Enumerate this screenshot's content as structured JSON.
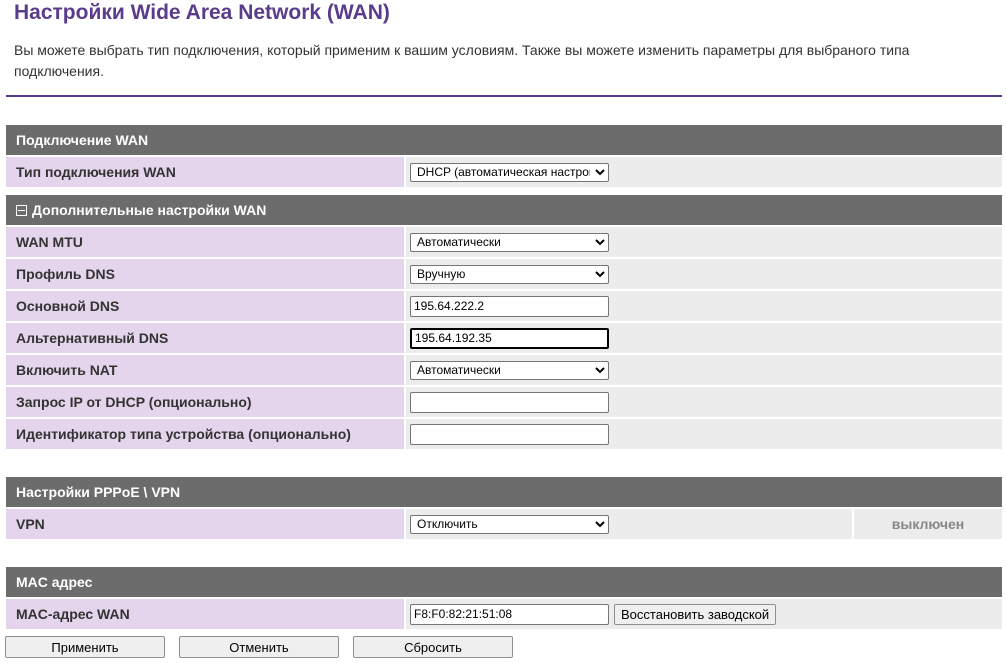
{
  "page": {
    "title": "Настройки Wide Area Network (WAN)",
    "description": "Вы можете выбрать тип подключения, который применим к вашим условиям. Также вы можете изменить параметры для выбраного типа подключения."
  },
  "wan_connection": {
    "header": "Подключение WAN",
    "type_label": "Тип подключения WAN",
    "type_value": "DHCP (автоматическая настройка)"
  },
  "advanced": {
    "header": "Дополнительные настройки WAN",
    "mtu_label": "WAN MTU",
    "mtu_value": "Автоматически",
    "dns_profile_label": "Профиль DNS",
    "dns_profile_value": "Вручную",
    "primary_dns_label": "Основной DNS",
    "primary_dns_value": "195.64.222.2",
    "alt_dns_label": "Альтернативный DNS",
    "alt_dns_value": "195.64.192.35",
    "nat_label": "Включить NAT",
    "nat_value": "Автоматически",
    "dhcp_ip_label": "Запрос IP от DHCP (опционально)",
    "dhcp_ip_value": "",
    "device_type_label": "Идентификатор типа устройства (опционально)",
    "device_type_value": ""
  },
  "pppoe": {
    "header": "Настройки PPPoE \\ VPN",
    "vpn_label": "VPN",
    "vpn_value": "Отключить",
    "vpn_status": "выключен"
  },
  "mac": {
    "header": "MAC адрес",
    "wan_mac_label": "MAC-адрес WAN",
    "wan_mac_value": "F8:F0:82:21:51:08",
    "restore_label": "Восстановить заводской"
  },
  "actions": {
    "apply": "Применить",
    "cancel": "Отменить",
    "reset": "Сбросить"
  },
  "colors": {
    "accent": "#5b3c8c",
    "section_header": "#6c6c6c",
    "label_bg": "#e4d5ec",
    "value_bg": "#ececec"
  }
}
